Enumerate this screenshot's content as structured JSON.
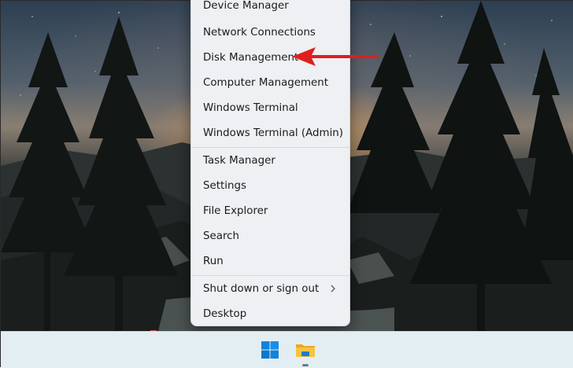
{
  "context_menu": {
    "group1": [
      {
        "label": "Device Manager"
      },
      {
        "label": "Network Connections"
      },
      {
        "label": "Disk Management"
      },
      {
        "label": "Computer Management"
      },
      {
        "label": "Windows Terminal"
      },
      {
        "label": "Windows Terminal (Admin)"
      }
    ],
    "group2": [
      {
        "label": "Task Manager"
      },
      {
        "label": "Settings"
      },
      {
        "label": "File Explorer"
      },
      {
        "label": "Search"
      },
      {
        "label": "Run"
      }
    ],
    "group3": [
      {
        "label": "Shut down or sign out",
        "has_submenu": true
      },
      {
        "label": "Desktop"
      }
    ]
  },
  "annotation": {
    "target": "Disk Management",
    "color": "#e01e1e"
  },
  "taskbar": {
    "icons": [
      "windows-start-icon",
      "file-explorer-icon"
    ],
    "active": "file-explorer-icon"
  },
  "colors": {
    "menu_bg": "#eef0f3",
    "taskbar_bg": "#e3eef3",
    "windows_blue": "#0a7bd6",
    "folder_yellow": "#f2b92e"
  }
}
